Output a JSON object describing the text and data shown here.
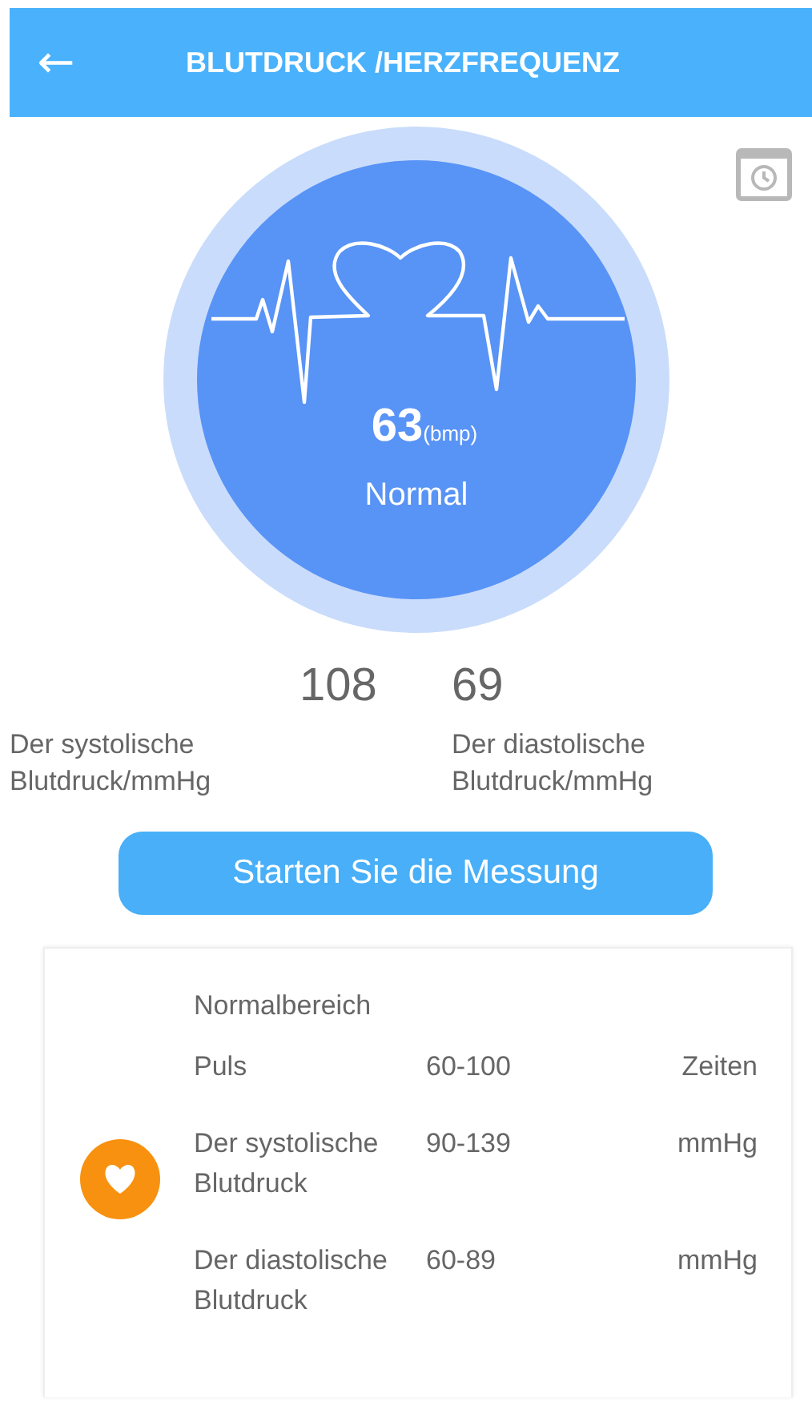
{
  "header": {
    "back_icon": "←",
    "title": "BLUTDRUCK /HERZFREQUENZ"
  },
  "dial": {
    "value": "63",
    "unit": "(bmp)",
    "status": "Normal"
  },
  "readings": [
    {
      "value": "108",
      "label": "Der systolische Blutdruck/mmHg"
    },
    {
      "value": "69",
      "label": "Der diastolische Blutdruck/mmHg"
    }
  ],
  "start_button": "Starten Sie die Messung",
  "range_card": {
    "title": "Normalbereich",
    "rows": [
      {
        "label": "Puls",
        "range": "60-100",
        "unit": "Zeiten"
      },
      {
        "label": "Der systolische Blutdruck",
        "range": "90-139",
        "unit": "mmHg"
      },
      {
        "label": "Der diastolische Blutdruck",
        "range": "60-89",
        "unit": "mmHg"
      }
    ]
  }
}
